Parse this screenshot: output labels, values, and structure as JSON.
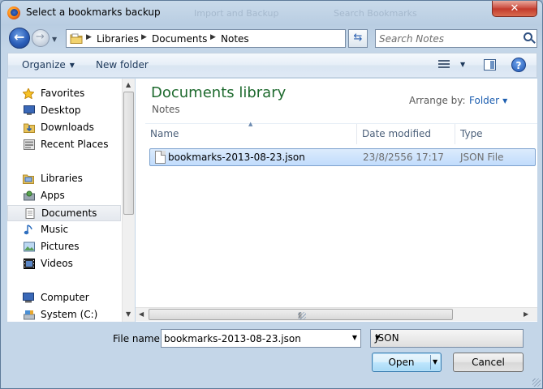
{
  "window": {
    "title": "Select a bookmarks backup",
    "close_label": "✕",
    "background_ghost": [
      "Import and Backup",
      "Search Bookmarks"
    ]
  },
  "address_bar": {
    "breadcrumbs": [
      "Libraries",
      "Documents",
      "Notes"
    ],
    "search_placeholder": "Search Notes"
  },
  "command_bar": {
    "organize": "Organize",
    "new_folder": "New folder",
    "help": "?"
  },
  "navigation": {
    "items": [
      {
        "label": "Favorites",
        "icon": "star-icon",
        "group": true
      },
      {
        "label": "Desktop",
        "icon": "desktop-icon"
      },
      {
        "label": "Downloads",
        "icon": "downloads-icon"
      },
      {
        "label": "Recent Places",
        "icon": "recent-places-icon"
      },
      {
        "label": "Libraries",
        "icon": "libraries-icon",
        "group": true
      },
      {
        "label": "Apps",
        "icon": "apps-icon"
      },
      {
        "label": "Documents",
        "icon": "documents-icon",
        "selected": true
      },
      {
        "label": "Music",
        "icon": "music-icon"
      },
      {
        "label": "Pictures",
        "icon": "pictures-icon"
      },
      {
        "label": "Videos",
        "icon": "videos-icon"
      },
      {
        "label": "Computer",
        "icon": "computer-icon",
        "group": true
      },
      {
        "label": "System (C:)",
        "icon": "drive-icon"
      }
    ]
  },
  "library": {
    "title": "Documents library",
    "subtitle": "Notes",
    "arrange_label": "Arrange by:",
    "arrange_value": "Folder"
  },
  "columns": [
    "Name",
    "Date modified",
    "Type"
  ],
  "files": [
    {
      "name": "bookmarks-2013-08-23.json",
      "date": "23/8/2556 17:17",
      "type": "JSON File",
      "selected": true
    }
  ],
  "footer": {
    "file_name_label": "File name:",
    "file_name_value": "bookmarks-2013-08-23.json",
    "file_type": "JSON",
    "open": "Open",
    "cancel": "Cancel"
  },
  "colors": {
    "library_title": "#1e6a2e",
    "link_blue": "#1e5fb0",
    "selection": "#c1dcfc"
  }
}
